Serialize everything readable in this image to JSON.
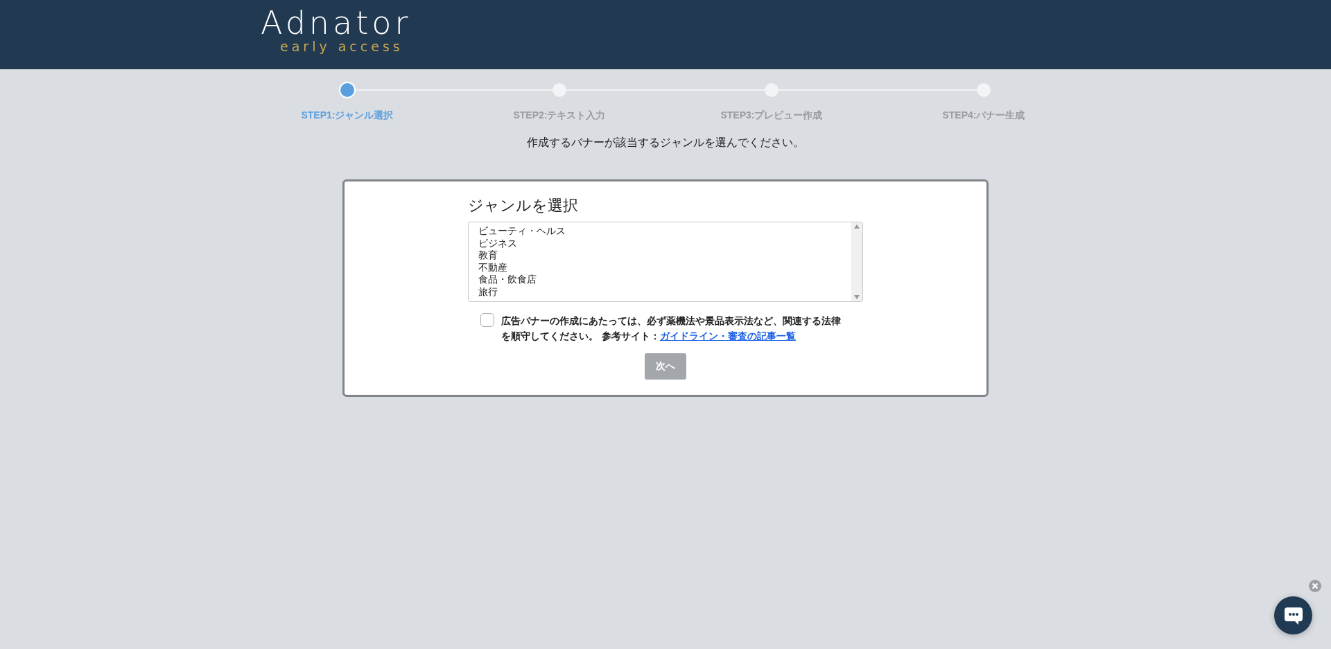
{
  "header": {
    "logo": "Adnator",
    "tagline": "early access"
  },
  "steps": [
    {
      "label": "STEP1:ジャンル選択",
      "selected": true
    },
    {
      "label": "STEP2:テキスト入力",
      "selected": false
    },
    {
      "label": "STEP3:プレビュー作成",
      "selected": false
    },
    {
      "label": "STEP4:バナー生成",
      "selected": false
    }
  ],
  "instruction": "作成するバナーが該当するジャンルを選んでください。",
  "card": {
    "title": "ジャンルを選択",
    "genres": [
      "ビューティ・ヘルス",
      "ビジネス",
      "教育",
      "不動産",
      "食品・飲食店",
      "旅行"
    ],
    "agreement": {
      "checked": false,
      "text": "広告バナーの作成にあたっては、必ず薬機法や景品表示法など、関連する法律を順守してください。 参考サイト：",
      "link": "ガイドライン・審査の記事一覧"
    },
    "next_button": {
      "label": "次へ",
      "disabled": true
    }
  }
}
